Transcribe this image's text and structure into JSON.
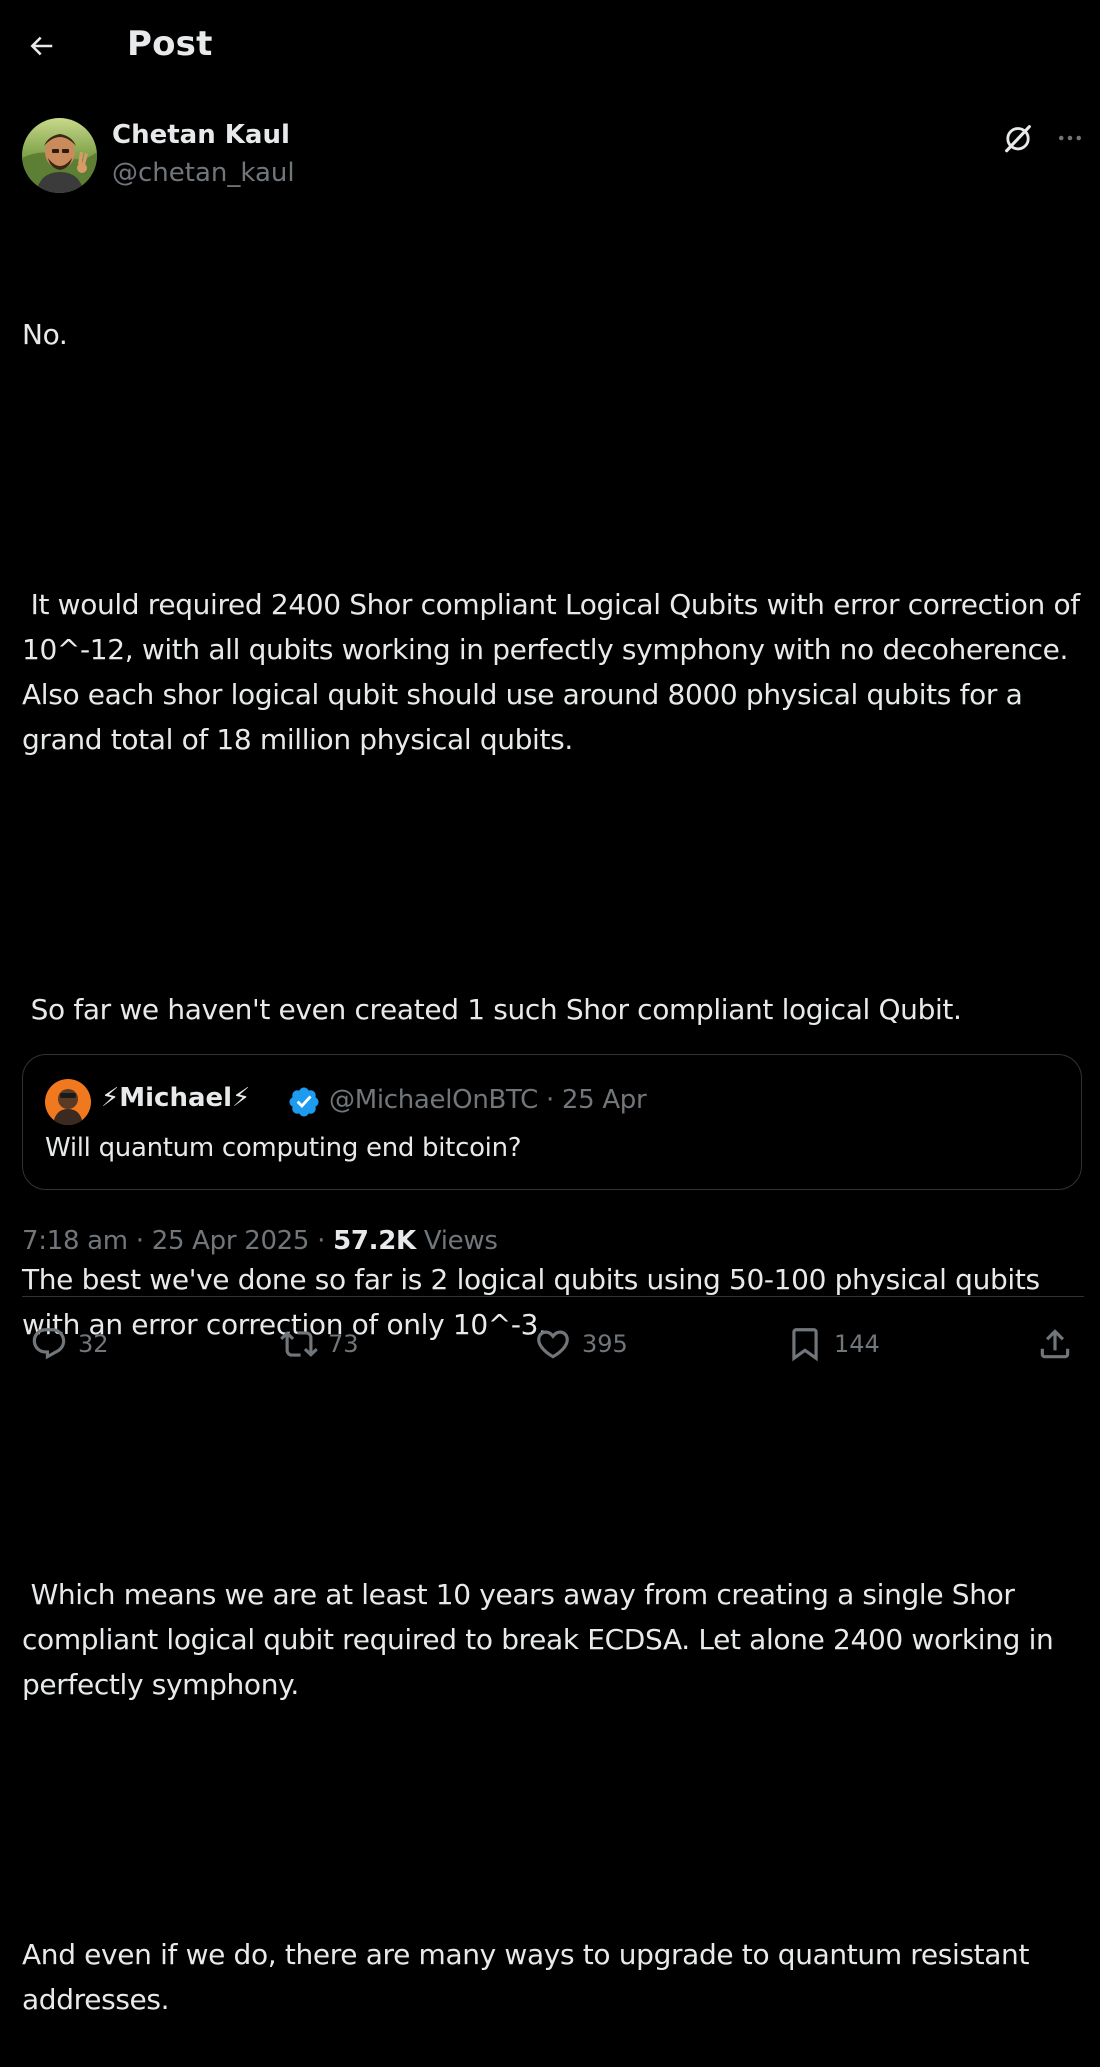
{
  "header": {
    "title": "Post",
    "back_icon": "back-arrow-icon"
  },
  "author": {
    "name": "Chetan Kaul",
    "handle": "@chetan_kaul"
  },
  "post": {
    "paragraphs": [
      "No.",
      " It would required 2400 Shor compliant Logical Qubits with error correction of 10^-12, with all qubits working in perfectly symphony with no decoherence. Also each shor logical qubit should use around 8000 physical qubits for a grand total of 18 million physical qubits.",
      " So far we haven't even created 1 such Shor compliant logical Qubit.",
      "The best we've done so far is 2 logical qubits using 50-100 physical qubits with an error correction of only 10^-3.",
      " Which means we are at least 10 years away from creating a single Shor compliant logical qubit required to break ECDSA. Let alone 2400 working in perfectly symphony.",
      "And even if we do, there are many ways to upgrade to quantum resistant addresses."
    ]
  },
  "quote": {
    "name": "⚡Michael⚡",
    "handle_date": "@MichaelOnBTC · 25 Apr",
    "text": "Will quantum computing end bitcoin?",
    "verified_color": "#1d9bf0"
  },
  "meta": {
    "timestamp": "7:18 am · 25 Apr 2025 · ",
    "views_count": "57.2K",
    "views_label": " Views"
  },
  "actions": {
    "replies": "32",
    "reposts": "73",
    "likes": "395",
    "bookmarks": "144"
  },
  "colors": {
    "background": "#000000",
    "text": "#e7e9ea",
    "muted": "#71767b",
    "border": "#2f3336",
    "accent": "#1d9bf0"
  }
}
